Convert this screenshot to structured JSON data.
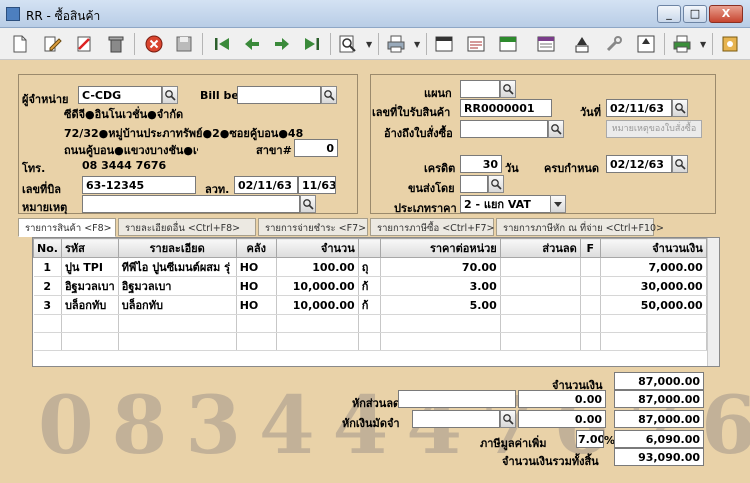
{
  "window": {
    "title": "RR - ซื้อสินค้า",
    "minimize": "_",
    "maximize": "□",
    "close": "X"
  },
  "toolbar": {
    "icons": [
      "new-icon",
      "edit-icon",
      "cancel-doc-icon",
      "trash-icon",
      "stop-icon",
      "save-icon",
      "first-icon",
      "prev-icon",
      "next-icon",
      "last-icon",
      "find-icon",
      "print-icon",
      "note-icon",
      "doc-icon",
      "po-icon",
      "report-icon",
      "ok-icon",
      "tools-icon",
      "ok2-icon",
      "printer2-icon",
      "settings-icon"
    ]
  },
  "supplier": {
    "label": "ผู้จำหน่าย",
    "code": "C-CDG",
    "name": "ซีดีจี●อินโนเวชั่น●จำกัด",
    "address1": "72/32●หมู่บ้านประภาทรัพย์●2●ซอยคู้บอน●48",
    "address2": "ถนนคู้บอน●แขวงบางชัน●เขตค",
    "phone_label": "โทร.",
    "phone": "08 3444 7676",
    "billbe_label": "Bill be",
    "billbe": "",
    "branch_label": "สาขา#",
    "branch": "0"
  },
  "invoice": {
    "bill_no_label": "เลขที่บิล",
    "bill_no": "63-12345",
    "date_label": "ลวท.",
    "date": "02/11/63",
    "date2": "11/63",
    "remark_label": "หมายเหตุ",
    "remark": ""
  },
  "receipt": {
    "dept_label": "แผนก",
    "dept": "",
    "receipt_no_label": "เลขที่ใบรับสินค้า",
    "receipt_no": "RR0000001",
    "day_label": "วันที่",
    "day": "02/11/63",
    "po_label": "อ้างถึงใบสั่งซื้อ",
    "po": "",
    "po_note_button": "หมายเหตุของใบสั่งซื้อ",
    "credit_label": "เครดิต",
    "credit": "30",
    "credit_unit": "วัน",
    "due_label": "ครบกำหนด",
    "due": "02/12/63",
    "ship_label": "ขนส่งโดย",
    "ship": "",
    "price_type_label": "ประเภทราคา",
    "price_type": "2 - แยก VAT"
  },
  "tabs": [
    {
      "label": "รายการสินค้า <F8>",
      "active": true
    },
    {
      "label": "รายละเอียดอื่น <Ctrl+F8>",
      "active": false
    },
    {
      "label": "รายการจ่ายชำระ <F7>",
      "active": false
    },
    {
      "label": "รายการภาษีซื้อ <Ctrl+F7>",
      "active": false
    },
    {
      "label": "รายการภาษีหัก ณ ที่จ่าย <Ctrl+F10>",
      "active": false
    }
  ],
  "grid": {
    "columns": [
      "No.",
      "รหัส",
      "รายละเอียด",
      "คลัง",
      "จำนวน",
      "",
      "ราคาต่อหน่วย",
      "ส่วนลด",
      "F",
      "จำนวนเงิน"
    ],
    "rows": [
      [
        "1",
        "ปูน TPI",
        "ทีพีไอ ปูนซีเมนต์ผสม รุ่",
        "HO",
        "100.00",
        "ถุ",
        "70.00",
        "",
        "",
        "7,000.00"
      ],
      [
        "2",
        "อิฐมวลเบา",
        "อิฐมวลเบา",
        "HO",
        "10,000.00",
        "ก้",
        "3.00",
        "",
        "",
        "30,000.00"
      ],
      [
        "3",
        "บล็อกทับ",
        "บล็อกทับ",
        "HO",
        "10,000.00",
        "ก้",
        "5.00",
        "",
        "",
        "50,000.00"
      ]
    ]
  },
  "totals": {
    "amount_label": "จำนวนเงิน",
    "amount": "87,000.00",
    "discount_label": "หักส่วนลด",
    "discount_text": "",
    "discount": "0.00",
    "after_discount": "87,000.00",
    "deposit_label": "หักเงินมัดจำ",
    "deposit_text": "",
    "deposit": "0.00",
    "after_deposit": "87,000.00",
    "vat_label": "ภาษีมูลค่าเพิ่ม",
    "vat_rate": "7.00",
    "vat_pct": "%",
    "vat": "6,090.00",
    "grand_label": "จำนวนเงินรวมทั้งสิ้น",
    "grand": "93,090.00"
  },
  "watermark": "0834447676"
}
